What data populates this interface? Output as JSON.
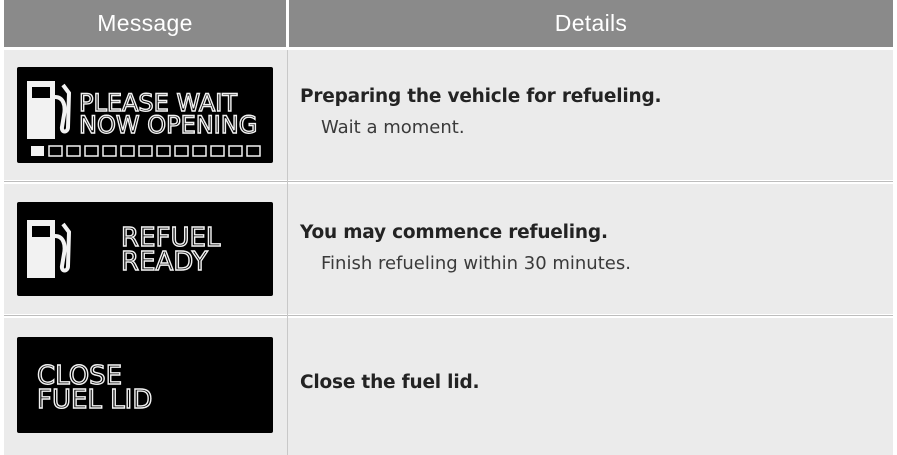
{
  "table": {
    "headers": {
      "message": "Message",
      "details": "Details"
    },
    "rows": [
      {
        "display_lines": [
          "PLEASE WAIT",
          "NOW OPENING"
        ],
        "title": "Preparing the vehicle for refueling.",
        "subtitle": "Wait a moment."
      },
      {
        "display_lines": [
          "REFUEL",
          "READY"
        ],
        "title": "You may commence refueling.",
        "subtitle": "Finish refueling within 30 minutes."
      },
      {
        "display_lines": [
          "CLOSE",
          "FUEL LID"
        ],
        "title": "Close the fuel lid.",
        "subtitle": ""
      }
    ]
  },
  "colors": {
    "header_bg": "#8a8a8a",
    "row_bg": "#ebebeb",
    "display_bg": "#000000",
    "display_fg": "#f2f2f2"
  },
  "icons": [
    "fuel-pump-icon",
    "progress-bar-icon"
  ]
}
